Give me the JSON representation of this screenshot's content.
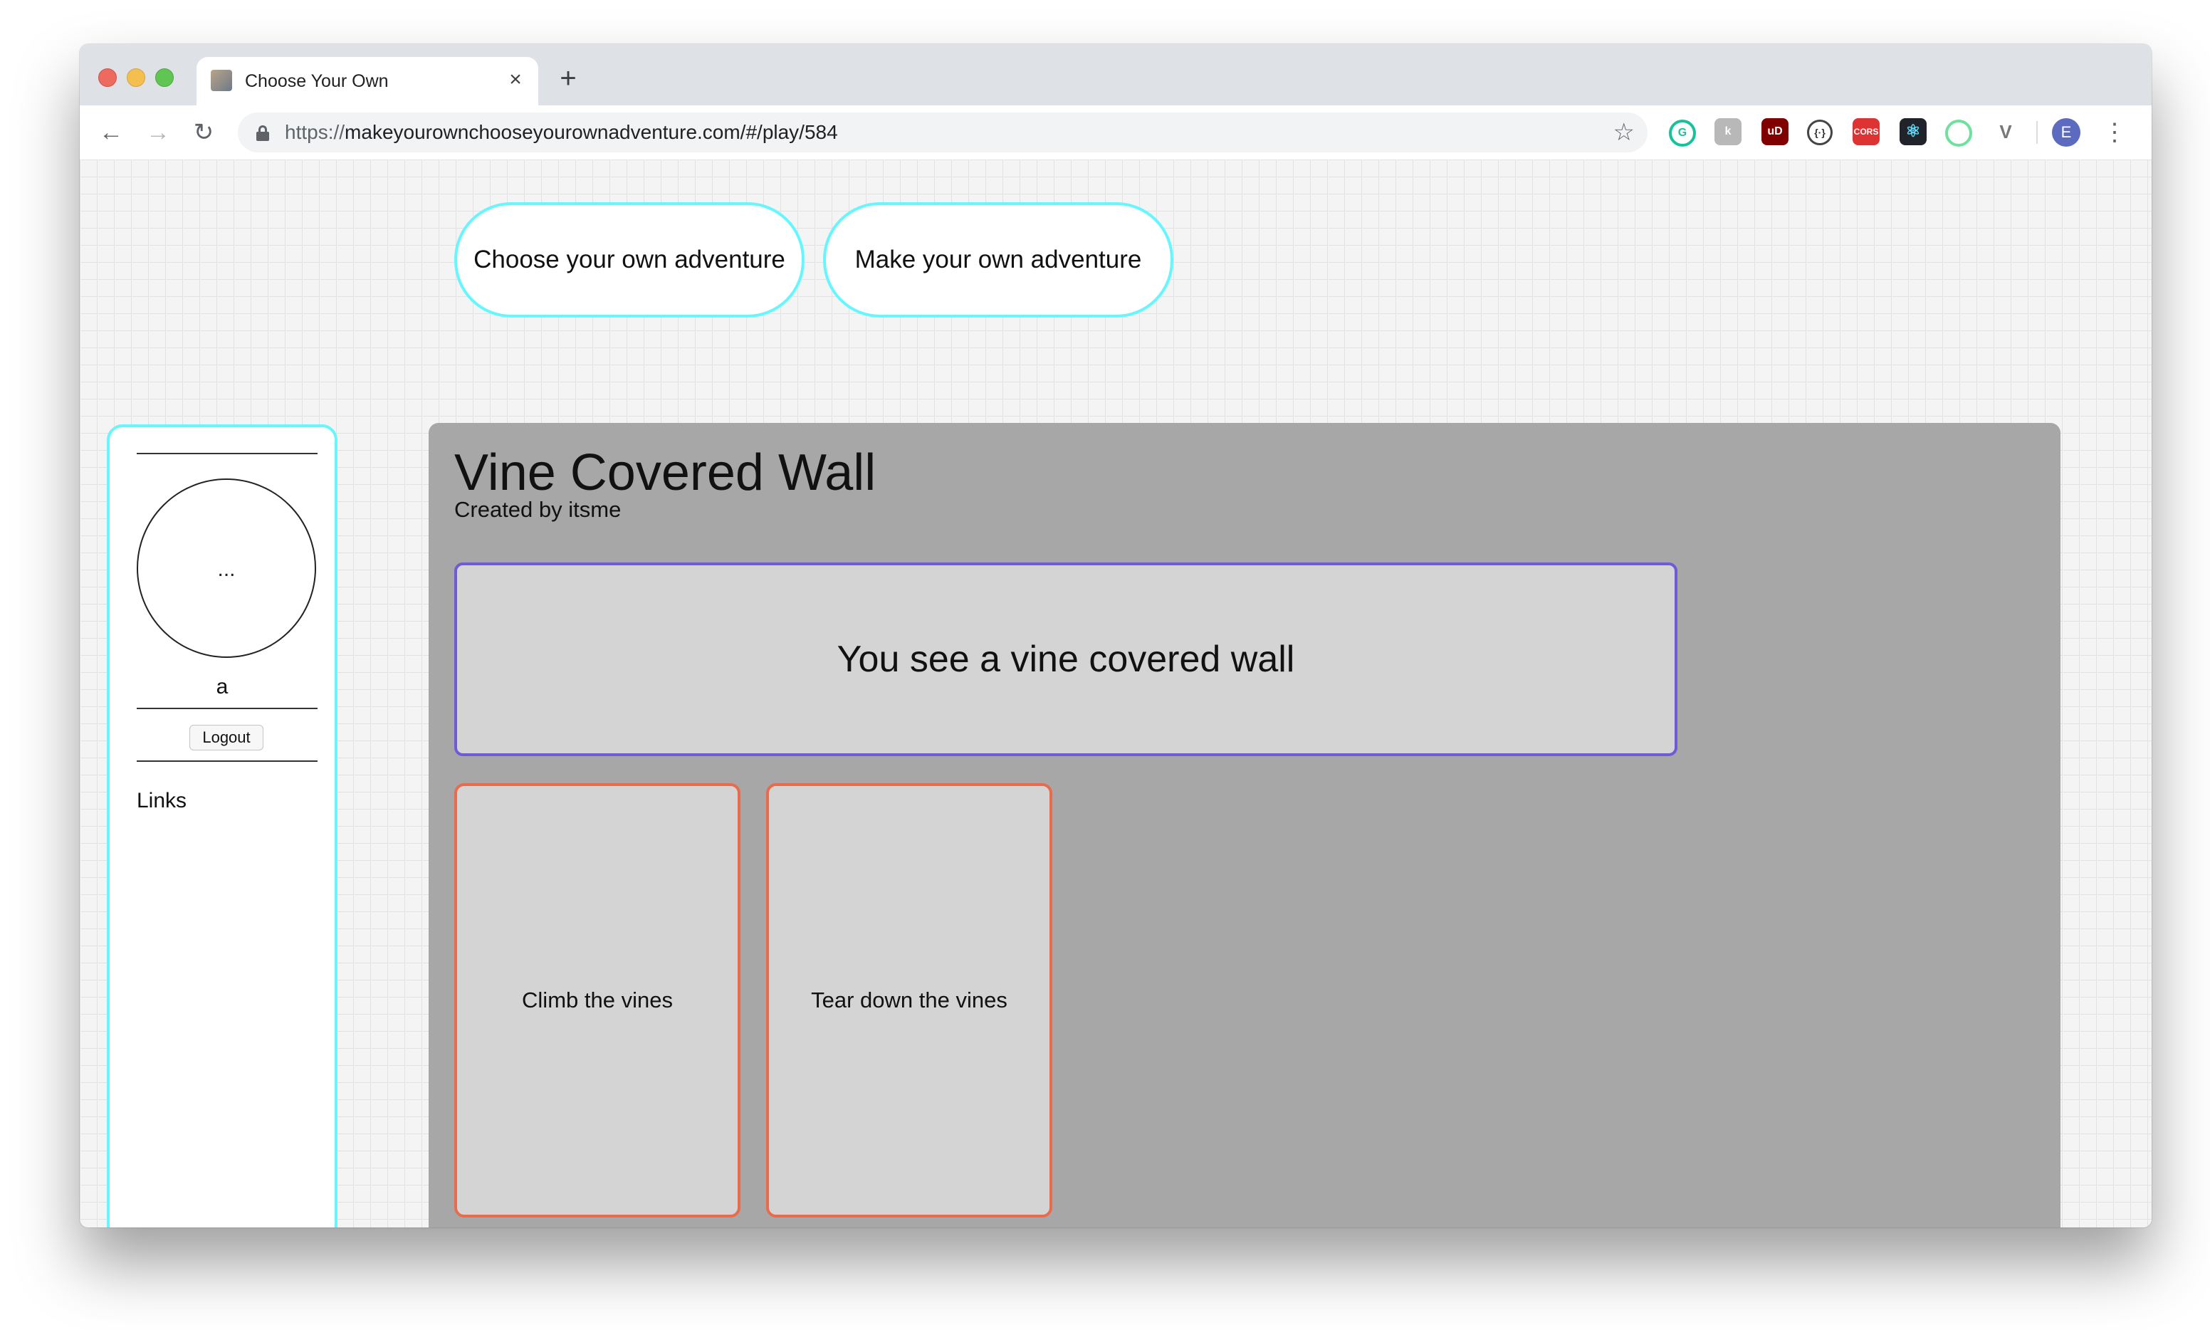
{
  "browser": {
    "tab_title": "Choose Your Own",
    "new_tab_symbol": "+",
    "close_symbol": "×",
    "url_scheme": "https://",
    "url_rest": "makeyourownchooseyourownadventure.com/#/play/584",
    "profile_initial": "E",
    "extensions": [
      "grammarly-icon",
      "k-extension-icon",
      "ublock-icon",
      "brackets-icon",
      "cors-icon",
      "react-devtools-icon",
      "ring-extension-icon",
      "vue-devtools-icon"
    ],
    "ext_labels": {
      "grammarly": "G",
      "k": "k",
      "ublock": "uD",
      "brackets": "{·}",
      "cors": "CORS",
      "react": "⚛",
      "vue": "V"
    }
  },
  "nav": {
    "choose_label": "Choose your own adventure",
    "make_label": "Make your own adventure"
  },
  "sidebar": {
    "avatar_text": "...",
    "username": "a",
    "logout_label": "Logout",
    "links_label": "Links"
  },
  "story": {
    "title": "Vine Covered Wall",
    "author": "Created by itsme",
    "scene_text": "You see a vine covered wall",
    "choices": [
      {
        "label": "Climb the vines"
      },
      {
        "label": "Tear down the vines"
      }
    ]
  },
  "colors": {
    "accent_cyan": "#66f6ff",
    "scene_border": "#6f5ad8",
    "choice_border": "#ea6a4c",
    "panel_bg": "#a7a7a7"
  }
}
